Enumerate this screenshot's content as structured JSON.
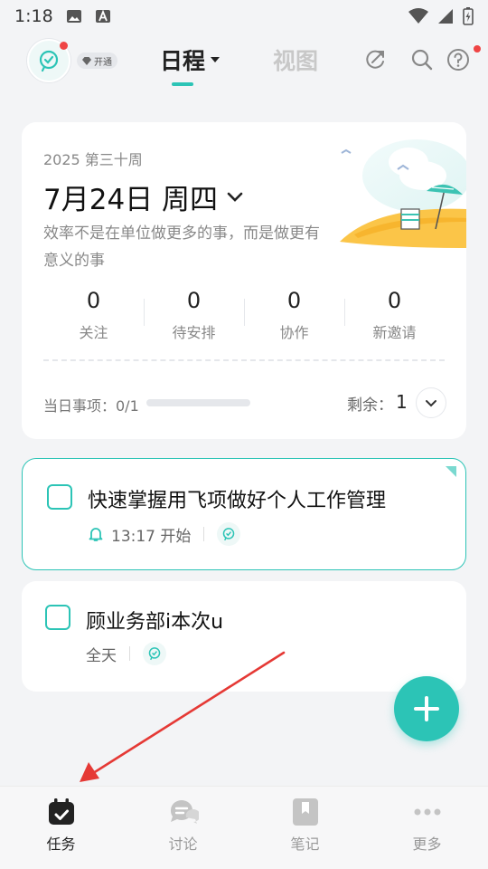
{
  "status_bar": {
    "time": "1:18"
  },
  "header": {
    "vip_label": "开通",
    "tab_schedule": "日程",
    "tab_view": "视图"
  },
  "summary": {
    "week": "2025 第三十周",
    "date": "7月24日 周四",
    "motto": "效率不是在单位做更多的事，而是做更有意义的事",
    "stats": [
      {
        "value": "0",
        "label": "关注"
      },
      {
        "value": "0",
        "label": "待安排"
      },
      {
        "value": "0",
        "label": "协作"
      },
      {
        "value": "0",
        "label": "新邀请"
      }
    ],
    "today_label": "当日事项：0/1",
    "today_progress": 0,
    "remain_label": "剩余：",
    "remain_value": "1"
  },
  "tasks": [
    {
      "title": "快速掌握用飞项做好个人工作管理",
      "meta": "13:17 开始",
      "highlighted": true
    },
    {
      "title": "顾业务部i本次u",
      "meta": "全天",
      "highlighted": false
    }
  ],
  "bottom_nav": [
    {
      "label": "任务",
      "icon": "calendar-check-icon",
      "active": true
    },
    {
      "label": "讨论",
      "icon": "chat-bubbles-icon",
      "active": false
    },
    {
      "label": "笔记",
      "icon": "bookmark-icon",
      "active": false
    },
    {
      "label": "更多",
      "icon": "more-dots-icon",
      "active": false
    }
  ],
  "colors": {
    "accent": "#2cc4b6",
    "alert": "#ef4444",
    "annotation": "#e53935"
  }
}
